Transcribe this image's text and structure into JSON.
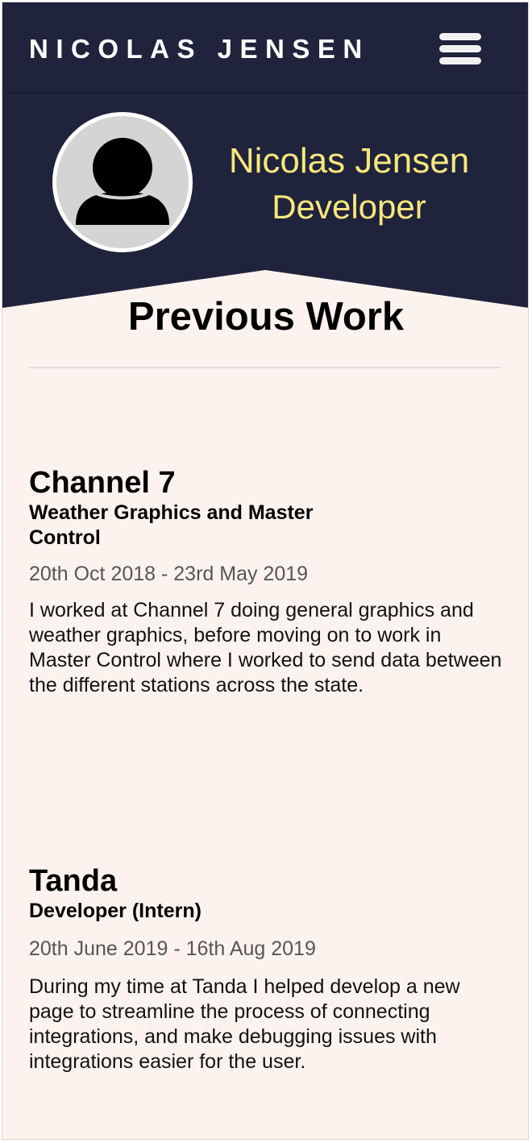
{
  "navbar": {
    "brand": "NICOLAS JENSEN",
    "menu_icon": "hamburger-menu-icon"
  },
  "hero": {
    "avatar_icon": "user-silhouette-icon",
    "name": "Nicolas Jensen",
    "role": "Developer"
  },
  "section": {
    "title": "Previous Work"
  },
  "jobs": [
    {
      "company": "Channel 7",
      "role": "Weather Graphics and Master Control",
      "dates": "20th Oct 2018 - 23rd May 2019",
      "description": "I worked at Channel 7 doing general graphics and weather graphics, before moving on to work in Master Control where I worked to send data between the different stations across the state."
    },
    {
      "company": "Tanda",
      "role": "Developer (Intern)",
      "dates": "20th June 2019 - 16th Aug 2019",
      "description": "During my time at Tanda I helped develop a new page to streamline the process of connecting integrations, and make debugging issues with integrations easier for the user."
    }
  ],
  "colors": {
    "navy": "#1f233b",
    "accent_yellow": "#f7e77e",
    "page_background": "#fcf3ef"
  }
}
